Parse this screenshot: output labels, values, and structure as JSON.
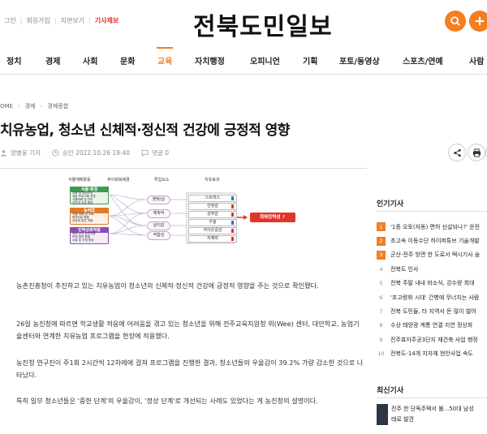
{
  "header": {
    "top_links": [
      "그인",
      "회원가입",
      "지면보기"
    ],
    "ad_link": "기사제보",
    "logo": "전북도민일보"
  },
  "nav": {
    "items": [
      "정치",
      "경제",
      "사회",
      "문화",
      "교육",
      "자치행정",
      "오피니언",
      "기획",
      "포토/동영상",
      "스포츠/연예",
      "사람"
    ],
    "active": "교육"
  },
  "breadcrumb": [
    "OME",
    "경제",
    "경제종합"
  ],
  "article": {
    "title": "치유농업, 청소년 신체적·정신적 건강에 긍정적 영향",
    "author": "양병웅 기자",
    "approved": "승인 2022.10.26 19:40",
    "comments": "댓글 0",
    "figure": {
      "headers": [
        "식물재배활동",
        "주이회복배경",
        "투입요소",
        "치유효과"
      ],
      "left_boxes": [
        {
          "label": "식물·환경",
          "sub": [
            "교육 및 환경조성",
            "체험 프로그램 운영",
            "식물재배 및 관리",
            "자연과 교감 활동"
          ],
          "color": "#3f9a52"
        },
        {
          "label": "농작업",
          "sub": [
            "작물 재배 및 수확",
            "원예치료 활동",
            "공동체 협업 체험"
          ],
          "color": "#e27a2a"
        },
        {
          "label": "인적상호작용",
          "sub": [
            "멘토·교사 상호작용",
            "또래 협력 활동",
            "소통 및 관계 형성"
          ],
          "color": "#8a4fb0"
        }
      ],
      "inputs": [
        "햇빛/날",
        "예촉적",
        "날이감",
        "적합성"
      ],
      "effects": [
        "스트레스",
        "안정감",
        "성취감",
        "우울",
        "자아존중감",
        "자제력"
      ],
      "result": "회복탄력성 ↑"
    },
    "paragraphs": [
      "농촌진흥청이 추진하고 있는 치유농업이 청소년의 신체적·정신적 건강에 긍정적 영향을 주는 것으로 확인됐다.",
      "26일 농진청에 따르면 학교생활 적응에 어려움을 겪고 있는 청소년을 위해 전주교육지원청 위(Wee) 센터, 대안학교, 농업기술센터와 연계한 치유농업 프로그램을 현장에 적용했다.",
      "농진청 연구진이 주1회 2시간씩 12차례에 걸쳐 프로그램을 진행한 결과, 청소년들의 우울감이 39.2% 가량 감소한 것으로 나타났다.",
      "특히 일부 청소년들은 '중한 단계'의 우울감이, '정상 단계'로 개선되는 사례도 있었다는 게 농진청의 설명이다."
    ]
  },
  "sidebar": {
    "popular_title": "인기기사",
    "popular": [
      {
        "num": "1",
        "text": "'1종 오토(자동) 면허 신설되나?' 운전"
      },
      {
        "num": "2",
        "text": "초고속 이동수단 하이퍼튜브 기술개발"
      },
      {
        "num": "3",
        "text": "군산-전주 방면 한 도로서 택시기사 숨"
      },
      {
        "num": "4",
        "text": "전북도 인사"
      },
      {
        "num": "5",
        "text": "전북 주말 내내 비소식, 강수량 최대"
      },
      {
        "num": "6",
        "text": "'초고령화 시대' 간병에 무너지는 사람"
      },
      {
        "num": "7",
        "text": "전북 도민들, 타 지역서 돈 많이 벌어"
      },
      {
        "num": "8",
        "text": "수상 태양광 계통 연결 지연 정상화"
      },
      {
        "num": "9",
        "text": "전주효자주공3단지 재건축 사업 행정"
      },
      {
        "num": "10",
        "text": "전북도-14개 지자체 현안사업 속도"
      }
    ],
    "latest_title": "최신기사",
    "latest_lines": [
      "전주 한 단독주택서 불...50대 남성",
      "태로 발견"
    ]
  },
  "colors": {
    "accent": "#f47e20",
    "hot_rank": "#f47e20",
    "result_red": "#e0342b"
  }
}
